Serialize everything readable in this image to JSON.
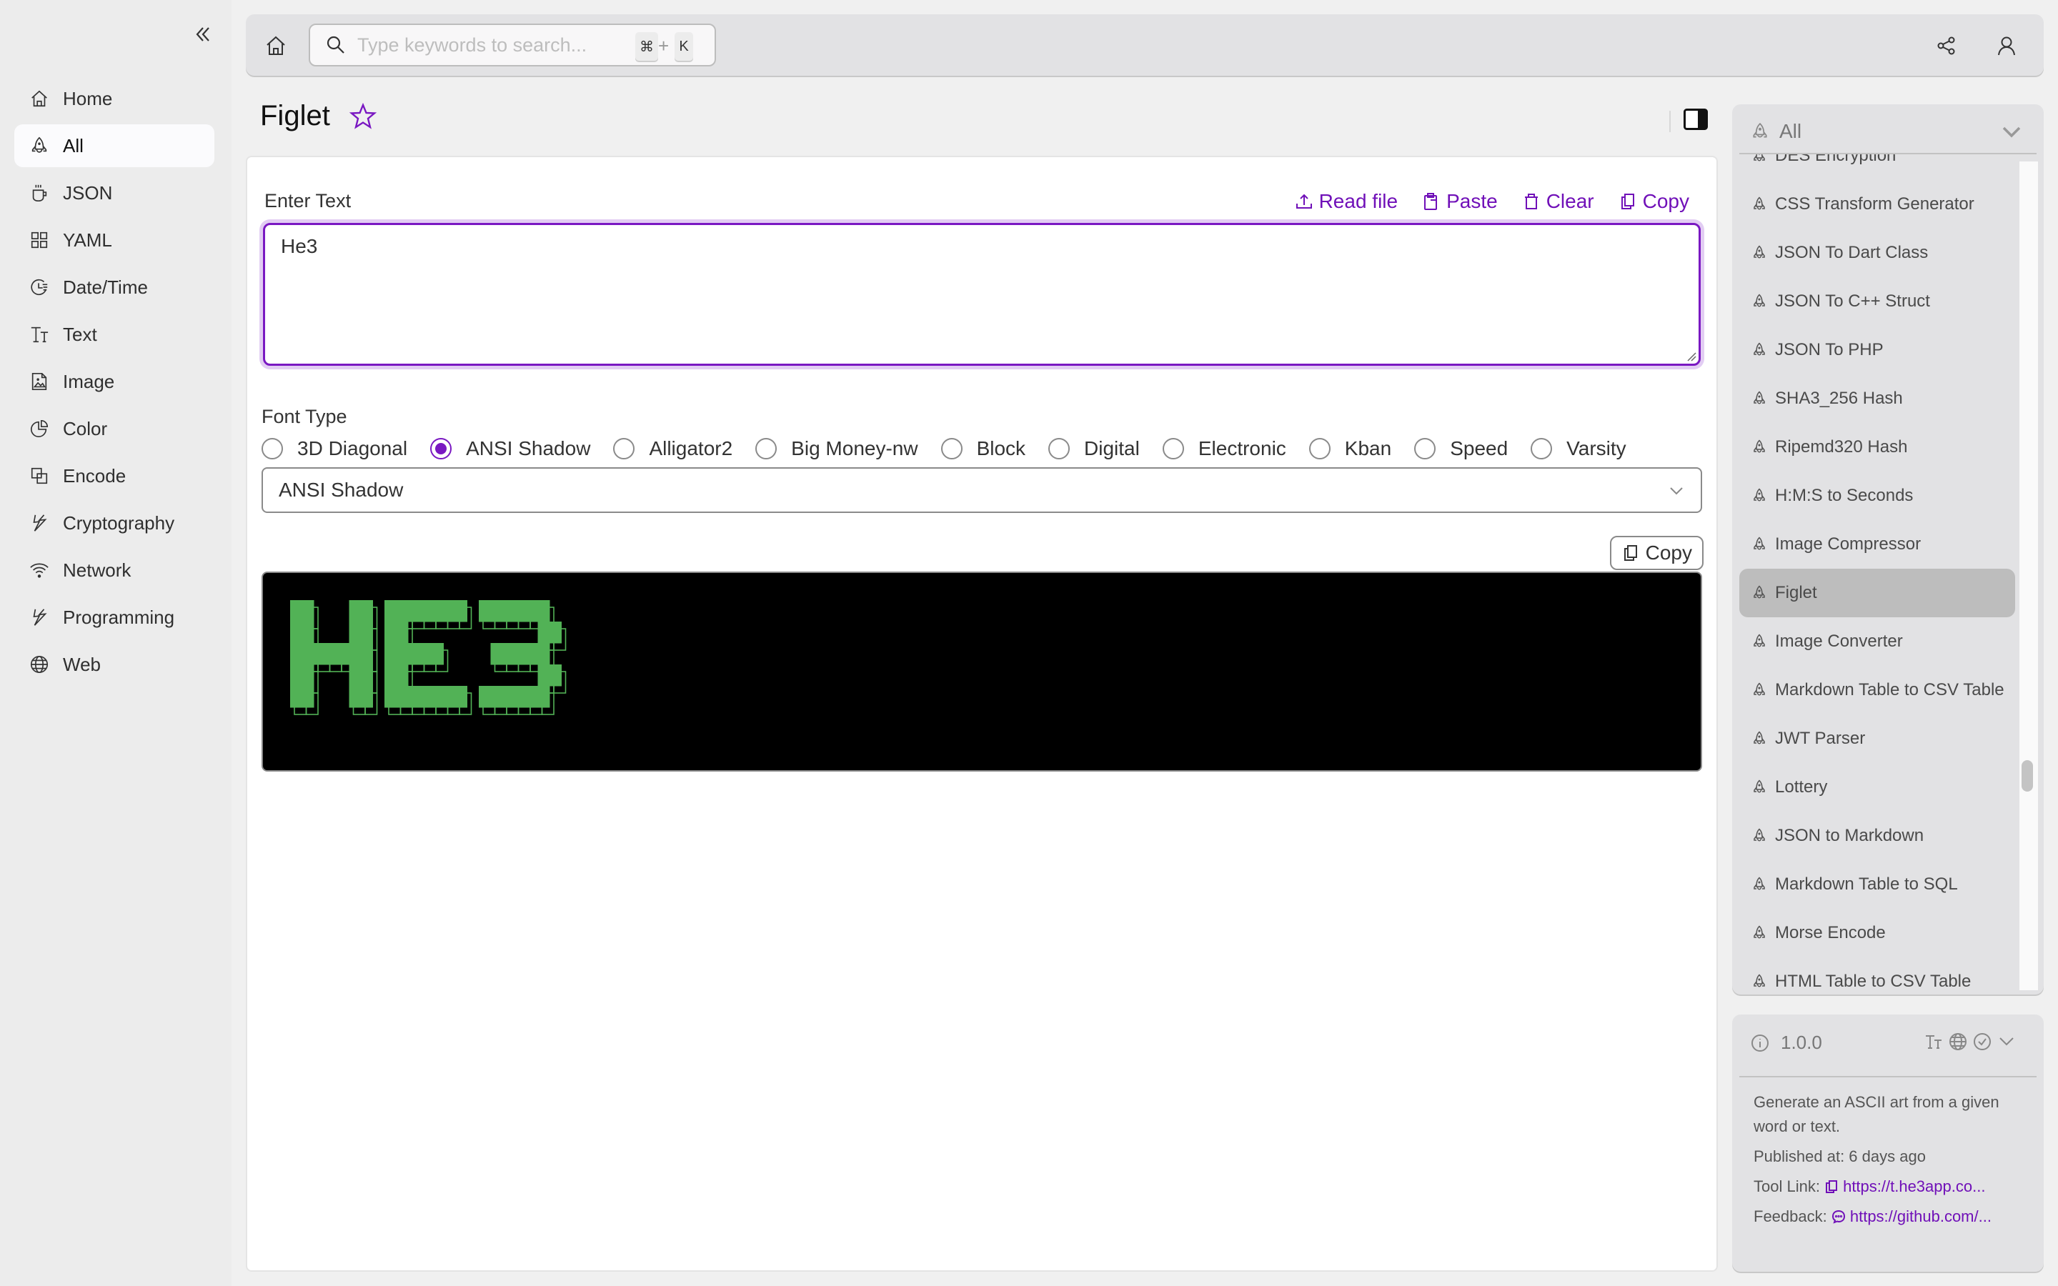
{
  "sidebar": {
    "collapse_label": "Collapse sidebar",
    "items": [
      {
        "label": "Home",
        "icon": "home-icon",
        "active": false
      },
      {
        "label": "All",
        "icon": "rocket-icon",
        "active": true
      },
      {
        "label": "JSON",
        "icon": "cup-icon",
        "active": false
      },
      {
        "label": "YAML",
        "icon": "grid-icon",
        "active": false
      },
      {
        "label": "Date/Time",
        "icon": "clock-icon",
        "active": false
      },
      {
        "label": "Text",
        "icon": "text-icon",
        "active": false
      },
      {
        "label": "Image",
        "icon": "image-file-icon",
        "active": false
      },
      {
        "label": "Color",
        "icon": "pie-icon",
        "active": false
      },
      {
        "label": "Encode",
        "icon": "squares-icon",
        "active": false
      },
      {
        "label": "Cryptography",
        "icon": "bolt-icon",
        "active": false
      },
      {
        "label": "Network",
        "icon": "wifi-icon",
        "active": false
      },
      {
        "label": "Programming",
        "icon": "bolt-icon",
        "active": false
      },
      {
        "label": "Web",
        "icon": "globe-icon",
        "active": false
      }
    ]
  },
  "topbar": {
    "search_placeholder": "Type keywords to search...",
    "search_value": "",
    "shortcut_key1": "⌘",
    "shortcut_plus": "+",
    "shortcut_key2": "K"
  },
  "page": {
    "title": "Figlet"
  },
  "editor": {
    "input_label": "Enter Text",
    "input_value": "He3",
    "actions": {
      "read_file": "Read file",
      "paste": "Paste",
      "clear": "Clear",
      "copy": "Copy"
    },
    "font_label": "Font Type",
    "fonts": [
      "3D Diagonal",
      "ANSI Shadow",
      "Alligator2",
      "Big Money-nw",
      "Block",
      "Digital",
      "Electronic",
      "Kban",
      "Speed",
      "Varsity"
    ],
    "selected_font": "ANSI Shadow",
    "output_copy": "Copy",
    "output_text": "HE3",
    "output_color": "#52b256"
  },
  "tool_list": {
    "category": "All",
    "items": [
      {
        "label": "DES Encryption",
        "selected": false
      },
      {
        "label": "CSS Transform Generator",
        "selected": false
      },
      {
        "label": "JSON To Dart Class",
        "selected": false
      },
      {
        "label": "JSON To C++ Struct",
        "selected": false
      },
      {
        "label": "JSON To PHP",
        "selected": false
      },
      {
        "label": "SHA3_256 Hash",
        "selected": false
      },
      {
        "label": "Ripemd320 Hash",
        "selected": false
      },
      {
        "label": "H:M:S to Seconds",
        "selected": false
      },
      {
        "label": "Image Compressor",
        "selected": false
      },
      {
        "label": "Figlet",
        "selected": true
      },
      {
        "label": "Image Converter",
        "selected": false
      },
      {
        "label": "Markdown Table to CSV Table",
        "selected": false
      },
      {
        "label": "JWT Parser",
        "selected": false
      },
      {
        "label": "Lottery",
        "selected": false
      },
      {
        "label": "JSON to Markdown",
        "selected": false
      },
      {
        "label": "Markdown Table to SQL",
        "selected": false
      },
      {
        "label": "Morse Encode",
        "selected": false
      },
      {
        "label": "HTML Table to CSV Table",
        "selected": false
      }
    ]
  },
  "info": {
    "version": "1.0.0",
    "description": "Generate an ASCII art from a given word or text.",
    "published": "Published at: 6 days ago",
    "tool_link_label": "Tool Link:",
    "tool_link": "https://t.he3app.co...",
    "feedback_label": "Feedback:",
    "feedback_link": "https://github.com/..."
  },
  "colors": {
    "accent": "#7a18c2",
    "output_bg": "#000000",
    "output_fg": "#52b256"
  }
}
